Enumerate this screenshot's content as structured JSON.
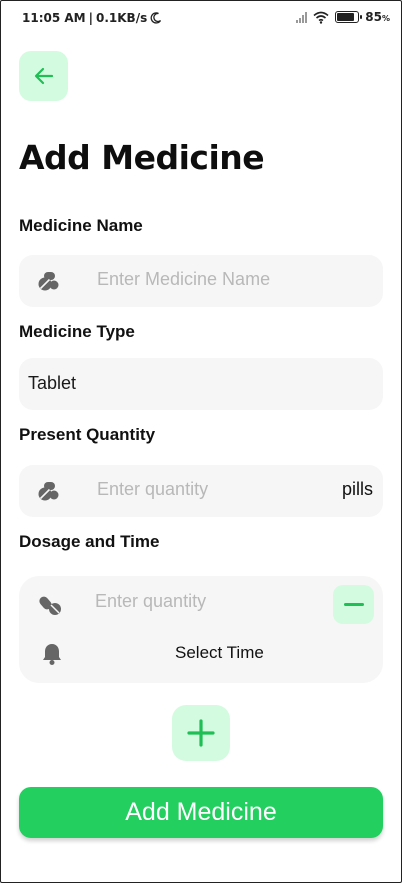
{
  "status_bar": {
    "time": "11:05 AM",
    "separator": "|",
    "speed": "0.1KB/s",
    "battery_percent": "85",
    "battery_unit": "%",
    "battery_level": 0.85
  },
  "header": {
    "title": "Add Medicine"
  },
  "form": {
    "medicine_name": {
      "label": "Medicine Name",
      "placeholder": "Enter Medicine Name",
      "icon": "pills-icon"
    },
    "medicine_type": {
      "label": "Medicine Type",
      "value": "Tablet"
    },
    "present_quantity": {
      "label": "Present Quantity",
      "placeholder": "Enter quantity",
      "suffix": "pills",
      "icon": "pills-icon"
    },
    "dosage": {
      "label": "Dosage and Time",
      "quantity_placeholder": "Enter quantity",
      "time_label": "Select Time",
      "dose_icon": "capsules-icon",
      "time_icon": "bell-icon"
    }
  },
  "actions": {
    "submit_label": "Add Medicine"
  },
  "colors": {
    "accent": "#22cf5f",
    "accent_light": "#d3fbe0",
    "field_bg": "#f6f6f6",
    "placeholder": "#b8b8b8"
  }
}
